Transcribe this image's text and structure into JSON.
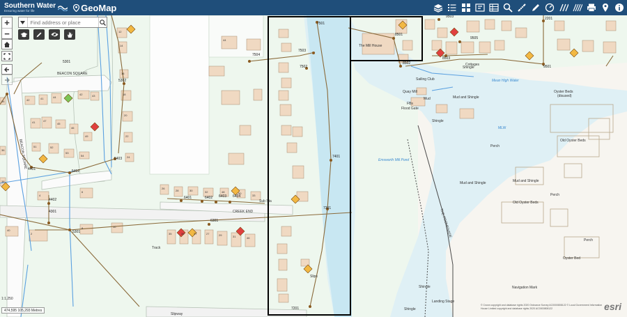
{
  "header": {
    "brand_name": "Southern Water",
    "brand_tagline": "Ensuring water for life",
    "app_title": "GeoMap",
    "toolbar_icons": [
      "layers-icon",
      "list-icon",
      "grid-icon",
      "flag-icon",
      "table-icon",
      "search-icon",
      "measure-icon",
      "draw-icon",
      "gauge-icon",
      "hatch-icon",
      "hatch-icon",
      "print-icon",
      "location-icon",
      "info-icon"
    ]
  },
  "search": {
    "placeholder": "Find address or place"
  },
  "zoom": {
    "in": "+",
    "out": "−"
  },
  "scale_text": "1:1,250",
  "coordinates": "474,595 105,293 Metres",
  "attribution": "© Crown copyright and database rights 2020 Ordnance Survey AC0000808122 © Local Government Information House Limited copyright and database rights 2020 AC0000808122",
  "esri": "esri",
  "map_labels": {
    "beacon_square": "BEACON SQUARE",
    "beacon_square_v": "BEACON SQUARE",
    "creek_end": "CREEK END",
    "track": "Track",
    "slipway": "Slipway",
    "sub_sta": "Sub Sta",
    "mill_house": "The Mill House",
    "sailing_club": "Sailing Club",
    "quay_mill": "Quay Mill",
    "mud": "Mud",
    "fb": "FBs",
    "flood_gate": "Flood Gate",
    "shingle1": "Shingle",
    "shingle2": "Shingle",
    "shingle3": "Shingle",
    "shingle4": "Shingle",
    "mud_shingle1": "Mud and Shingle",
    "mud_shingle2": "Mud and Shingle",
    "mud_shingle3": "Mud and Shingle",
    "mean_high_water": "Mean High Water",
    "oyster_beds1": "Oyster Beds",
    "oyster_beds1_sub": "(disused)",
    "oyster_beds2": "Old Oyster Beds",
    "oyster_beds3": "Old Oyster Beds",
    "oyster_bed": "Oyster Bed",
    "perch1": "Perch",
    "perch2": "Perch",
    "perch3": "Perch",
    "emsworth_mill_pond": "Emsworth Mill Pond",
    "the_promenade": "THE PROMENADE",
    "navigation_mark": "Navigation Mark",
    "landing_stage": "Landing Stage",
    "mlw": "MLW",
    "cottages": "Cottages",
    "slips": "Slips"
  },
  "node_labels": {
    "n5301": "5301",
    "n5302": "5302",
    "n4401": "4401",
    "n5402": "5402",
    "n5403": "5403",
    "n4402": "4402",
    "n4301": "4301",
    "n5301b": "5301",
    "n6401": "6401",
    "n6402": "6402",
    "n6403": "6403",
    "n6404": "6404",
    "n6301": "6301",
    "n7501": "7501",
    "n7504": "7504",
    "n7503": "7503",
    "n7502": "7502",
    "n7401": "7401",
    "n7301": "7301",
    "n7201": "7201",
    "n8501": "8501",
    "n8502": "8502",
    "n9501": "9501",
    "n9505": "9505",
    "n9503": "9503",
    "n8503": "8503",
    "n2201": "2201"
  },
  "house_numbers": [
    "42",
    "41",
    "44",
    "42",
    "43",
    "41",
    "47",
    "45",
    "46",
    "49",
    "51",
    "52",
    "53",
    "54",
    "34",
    "36",
    "38",
    "40",
    "2",
    "4",
    "6",
    "8",
    "10",
    "12",
    "14",
    "16",
    "18",
    "20",
    "22",
    "24",
    "26",
    "28",
    "30",
    "32",
    "48",
    "50",
    "33",
    "35",
    "39",
    "37",
    "27",
    "29",
    "31",
    "46",
    "44"
  ]
}
